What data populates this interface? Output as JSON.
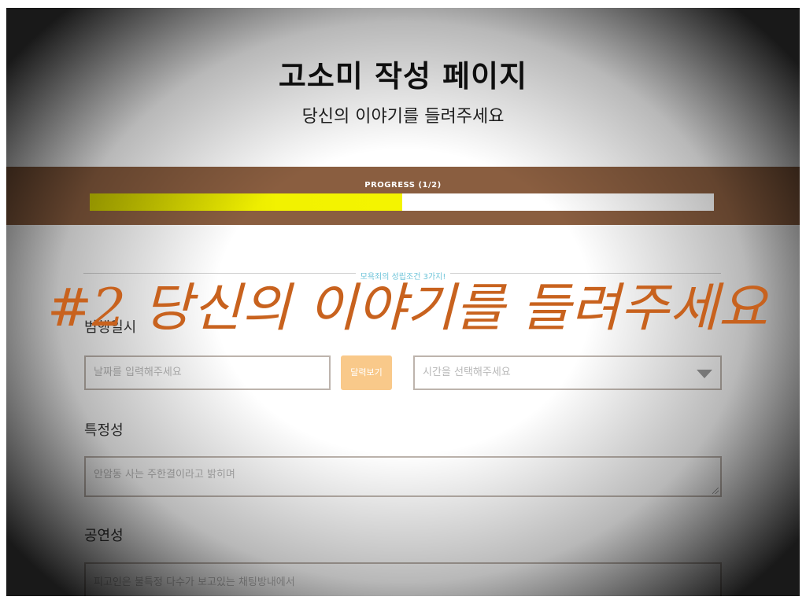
{
  "header": {
    "title": "고소미 작성 페이지",
    "subtitle": "당신의 이야기를 들려주세요"
  },
  "progress": {
    "label": "PROGRESS (1/2)",
    "value": 0.5
  },
  "section": {
    "rule_label": "모욕죄의 성립조건 3가지!"
  },
  "fields": {
    "datetime": {
      "label": "범행일시",
      "date_placeholder": "날짜를 입력해주세요",
      "calendar_button": "달력보기",
      "time_placeholder": "시간을 선택해주세요"
    },
    "specificity": {
      "label": "특정성",
      "placeholder": "안암동 사는 주한결이라고 밝히며"
    },
    "publicity": {
      "label": "공연성",
      "placeholder": "피고인은 불특정 다수가 보고있는 채팅방내에서"
    }
  },
  "overlay": {
    "annotation": "#2 당신의 이야기를 들려주세요"
  },
  "colors": {
    "progress_band": "#8a5e40",
    "progress_fill": "#f2f200",
    "calendar_button": "#f9c98a",
    "rule_label": "#6cc3d8",
    "annotation": "#c8621e"
  }
}
